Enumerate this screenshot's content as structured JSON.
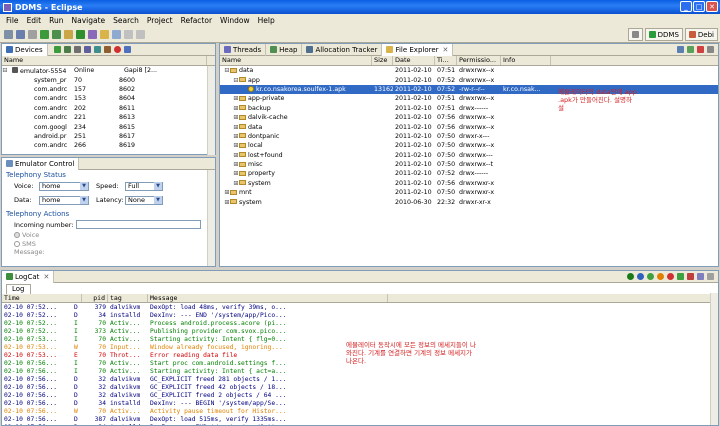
{
  "window": {
    "title": "DDMS - Eclipse"
  },
  "menu": [
    "File",
    "Edit",
    "Run",
    "Navigate",
    "Search",
    "Project",
    "Refactor",
    "Window",
    "Help"
  ],
  "perspectives": [
    {
      "label": "DDMS"
    },
    {
      "label": "Debi"
    }
  ],
  "devices": {
    "tab_label": "Devices",
    "headers": {
      "name": "Name"
    },
    "emulator": {
      "name": "emulator-5554",
      "status": "Online",
      "api": "Gapi8 [2..."
    },
    "processes": [
      {
        "name": "system_pr",
        "pid": "70",
        "port": "8600"
      },
      {
        "name": "com.andrc",
        "pid": "157",
        "port": "8602"
      },
      {
        "name": "com.andrc",
        "pid": "153",
        "port": "8604"
      },
      {
        "name": "com.andrc",
        "pid": "202",
        "port": "8611"
      },
      {
        "name": "com.andrc",
        "pid": "221",
        "port": "8613"
      },
      {
        "name": "com.googl",
        "pid": "234",
        "port": "8615"
      },
      {
        "name": "android.pr",
        "pid": "251",
        "port": "8617"
      },
      {
        "name": "com.andrc",
        "pid": "266",
        "port": "8619"
      }
    ]
  },
  "emulator_control": {
    "tab_label": "Emulator Control",
    "telephony_status": "Telephony Status",
    "voice_label": "Voice:",
    "voice_value": "home",
    "speed_label": "Speed:",
    "speed_value": "Full",
    "data_label": "Data:",
    "data_value": "home",
    "latency_label": "Latency:",
    "latency_value": "None",
    "telephony_actions": "Telephony Actions",
    "incoming_label": "Incoming number:",
    "voice_radio": "Voice",
    "sms_radio": "SMS",
    "message_label": "Message:"
  },
  "tabs": [
    {
      "label": "Threads"
    },
    {
      "label": "Heap"
    },
    {
      "label": "Allocation Tracker"
    },
    {
      "label": "File Explorer"
    }
  ],
  "file_explorer": {
    "headers": {
      "name": "Name",
      "size": "Size",
      "date": "Date",
      "time": "Ti...",
      "perm": "Permissio...",
      "info": "Info"
    },
    "rows": [
      {
        "indent": 0,
        "tw": "⊟",
        "name": "data",
        "size": "",
        "date": "2011-02-10",
        "time": "07:51",
        "perm": "drwxrwx--x",
        "info": ""
      },
      {
        "indent": 1,
        "tw": "⊟",
        "name": "app",
        "size": "",
        "date": "2011-02-10",
        "time": "07:52",
        "perm": "drwxrwx--x",
        "info": ""
      },
      {
        "indent": 2,
        "tw": "",
        "name": "kr.co.nsakorea.soulfex-1.apk",
        "size": "13162",
        "date": "2011-02-10",
        "time": "07:52",
        "perm": "-rw-r--r--",
        "info": "kr.co.nsak...",
        "selected": true,
        "file": true
      },
      {
        "indent": 1,
        "tw": "⊞",
        "name": "app-private",
        "size": "",
        "date": "2011-02-10",
        "time": "07:51",
        "perm": "drwxrwx--x",
        "info": ""
      },
      {
        "indent": 1,
        "tw": "⊞",
        "name": "backup",
        "size": "",
        "date": "2011-02-10",
        "time": "07:51",
        "perm": "drwx------",
        "info": ""
      },
      {
        "indent": 1,
        "tw": "⊞",
        "name": "dalvik-cache",
        "size": "",
        "date": "2011-02-10",
        "time": "07:56",
        "perm": "drwxrwx--x",
        "info": ""
      },
      {
        "indent": 1,
        "tw": "⊞",
        "name": "data",
        "size": "",
        "date": "2011-02-10",
        "time": "07:56",
        "perm": "drwxrwx--x",
        "info": ""
      },
      {
        "indent": 1,
        "tw": "⊞",
        "name": "dontpanic",
        "size": "",
        "date": "2011-02-10",
        "time": "07:50",
        "perm": "drwxr-x---",
        "info": ""
      },
      {
        "indent": 1,
        "tw": "⊞",
        "name": "local",
        "size": "",
        "date": "2011-02-10",
        "time": "07:50",
        "perm": "drwxrwx--x",
        "info": ""
      },
      {
        "indent": 1,
        "tw": "⊞",
        "name": "lost+found",
        "size": "",
        "date": "2011-02-10",
        "time": "07:50",
        "perm": "drwxrwx---",
        "info": ""
      },
      {
        "indent": 1,
        "tw": "⊞",
        "name": "misc",
        "size": "",
        "date": "2011-02-10",
        "time": "07:50",
        "perm": "drwxrwx--t",
        "info": ""
      },
      {
        "indent": 1,
        "tw": "⊞",
        "name": "property",
        "size": "",
        "date": "2011-02-10",
        "time": "07:52",
        "perm": "drwx------",
        "info": ""
      },
      {
        "indent": 1,
        "tw": "⊞",
        "name": "system",
        "size": "",
        "date": "2011-02-10",
        "time": "07:56",
        "perm": "drwxrwxr-x",
        "info": ""
      },
      {
        "indent": 0,
        "tw": "⊞",
        "name": "mnt",
        "size": "",
        "date": "2011-02-10",
        "time": "07:50",
        "perm": "drwxrwxr-x",
        "info": ""
      },
      {
        "indent": 0,
        "tw": "⊞",
        "name": "system",
        "size": "",
        "date": "2010-06-30",
        "time": "22:32",
        "perm": "drwxr-xr-x",
        "info": ""
      }
    ],
    "annotation": "에뮬레이터의 data안에 app\n.apk가 만들어진다. 설명하\n설"
  },
  "logcat": {
    "tab_label": "LogCat",
    "subtab": "Log",
    "headers": {
      "time": "Time",
      "pid": "pid",
      "tag": "tag",
      "message": "Message"
    },
    "rows": [
      {
        "time": "02-10 07:52...",
        "lvl": "D",
        "pid": "379",
        "tag": "dalvikvm",
        "msg": "DexOpt: load 48ms, verify 39ms, o...",
        "color": "#000080"
      },
      {
        "time": "02-10 07:52...",
        "lvl": "D",
        "pid": "34",
        "tag": "installd",
        "msg": "DexInv: --- END '/system/app/Pico...",
        "color": "#000080"
      },
      {
        "time": "02-10 07:52...",
        "lvl": "I",
        "pid": "70",
        "tag": "Activ...",
        "msg": "Process android.process.acore (pi...",
        "color": "#008000"
      },
      {
        "time": "02-10 07:52...",
        "lvl": "I",
        "pid": "373",
        "tag": "Activ...",
        "msg": "Publishing provider com.svox.pico...",
        "color": "#008000"
      },
      {
        "time": "02-10 07:53...",
        "lvl": "I",
        "pid": "70",
        "tag": "Activ...",
        "msg": "Starting activity: Intent { flg=0...",
        "color": "#008000"
      },
      {
        "time": "02-10 07:53...",
        "lvl": "W",
        "pid": "70",
        "tag": "Input...",
        "msg": "Window already focused, ignoring...",
        "color": "#e08000"
      },
      {
        "time": "02-10 07:53...",
        "lvl": "E",
        "pid": "70",
        "tag": "Throt...",
        "msg": "Error reading data file",
        "color": "#d00000"
      },
      {
        "time": "02-10 07:56...",
        "lvl": "I",
        "pid": "70",
        "tag": "Activ...",
        "msg": "Start proc com.android.settings f...",
        "color": "#008000"
      },
      {
        "time": "02-10 07:56...",
        "lvl": "I",
        "pid": "70",
        "tag": "Activ...",
        "msg": "Starting activity: Intent { act=a...",
        "color": "#008000"
      },
      {
        "time": "02-10 07:56...",
        "lvl": "D",
        "pid": "32",
        "tag": "dalvikvm",
        "msg": "GC_EXPLICIT freed 281 objects / 1...",
        "color": "#000080"
      },
      {
        "time": "02-10 07:56...",
        "lvl": "D",
        "pid": "32",
        "tag": "dalvikvm",
        "msg": "GC_EXPLICIT freed 42 objects / 18...",
        "color": "#000080"
      },
      {
        "time": "02-10 07:56...",
        "lvl": "D",
        "pid": "32",
        "tag": "dalvikvm",
        "msg": "GC_EXPLICIT freed 2 objects / 64 ...",
        "color": "#000080"
      },
      {
        "time": "02-10 07:56...",
        "lvl": "D",
        "pid": "34",
        "tag": "installd",
        "msg": "DexInv: --- BEGIN '/system/app/Se...",
        "color": "#000080"
      },
      {
        "time": "02-10 07:56...",
        "lvl": "W",
        "pid": "70",
        "tag": "Activ...",
        "msg": "Activity pause timeout for Histor...",
        "color": "#e08000"
      },
      {
        "time": "02-10 07:56...",
        "lvl": "D",
        "pid": "387",
        "tag": "dalvikvm",
        "msg": "DexOpt: load 515ms, verify 1335ms...",
        "color": "#000080"
      },
      {
        "time": "02-10 07:56...",
        "lvl": "D",
        "pid": "34",
        "tag": "installd",
        "msg": "DexInv: --- END '/system/app/Sett...",
        "color": "#000080"
      }
    ],
    "annotation": "에뮬레이터 동작시에 모든 정보의 메세지들이 나\n와진다. 기계를 연결하면 기계의 정보 메세지가\n나온다."
  }
}
